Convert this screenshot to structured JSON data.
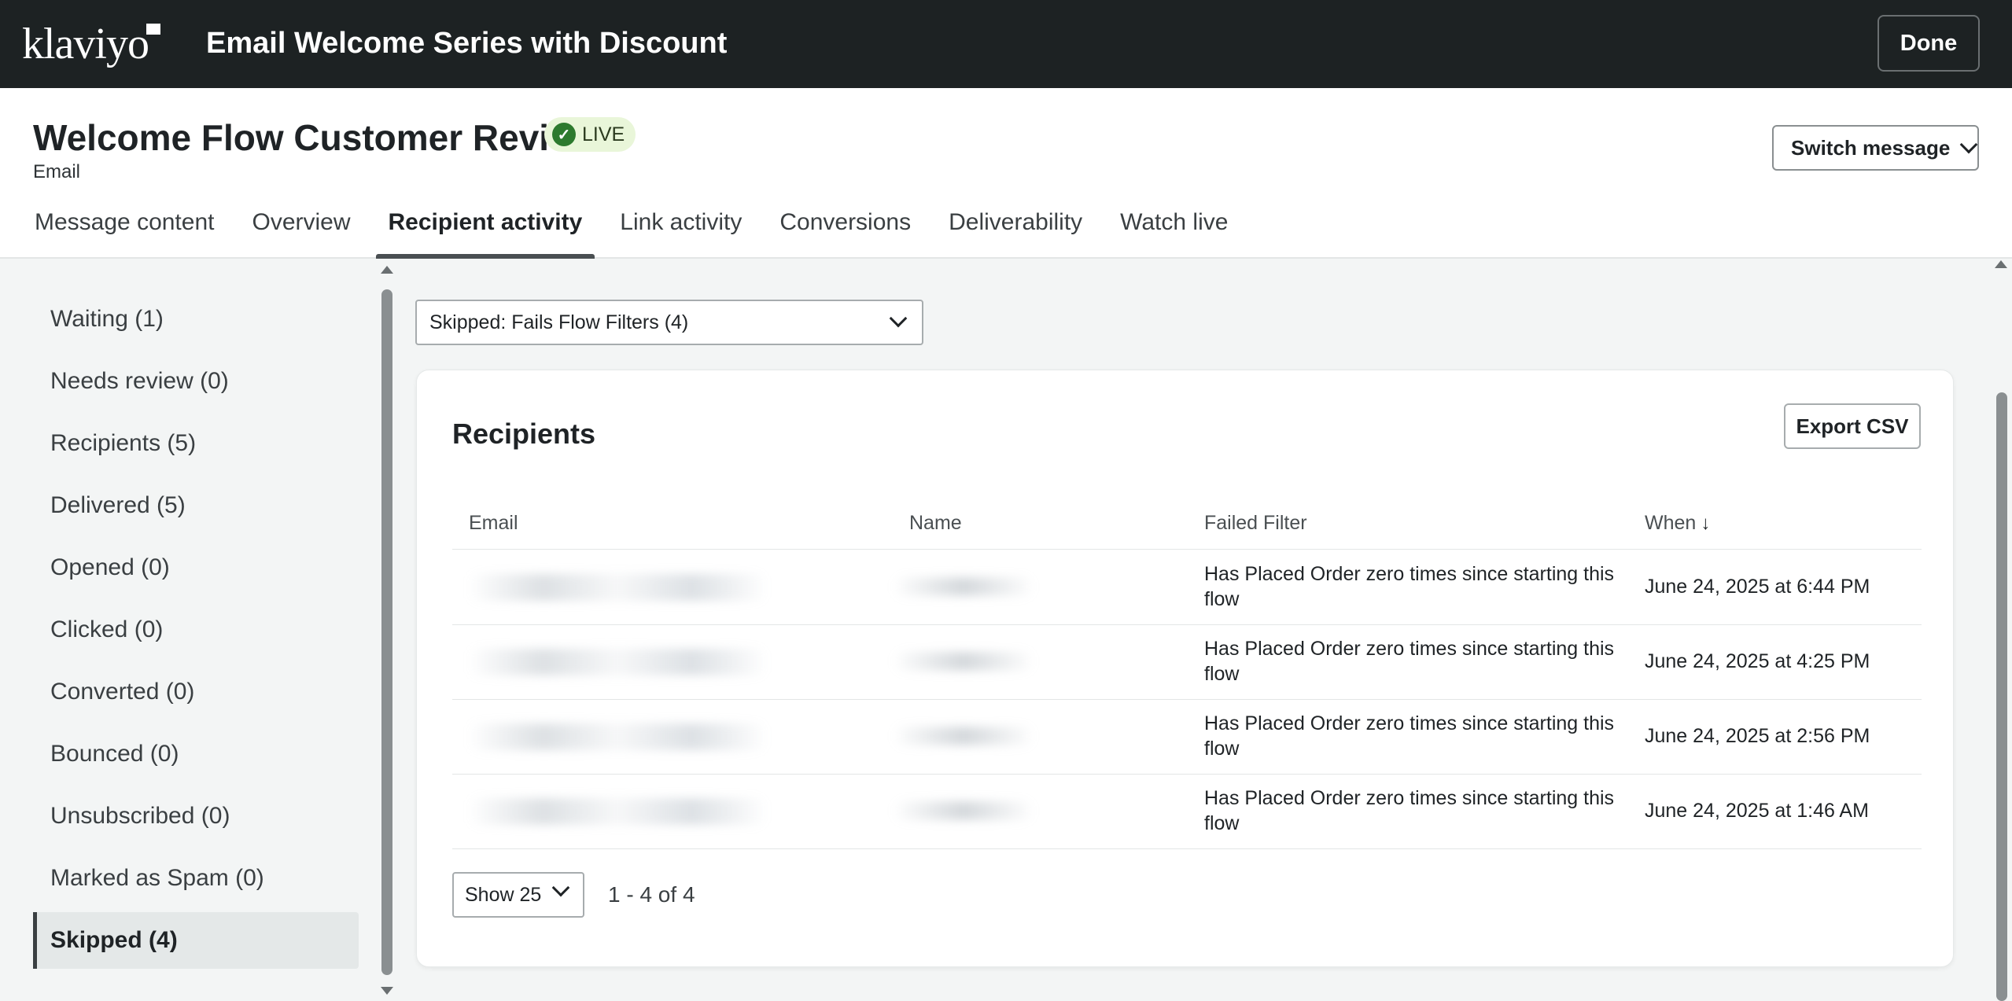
{
  "app": {
    "logo": "klaviyo",
    "flow_title": "Email Welcome Series with Discount",
    "done_label": "Done"
  },
  "message": {
    "title": "Welcome Flow Customer Review",
    "status": "LIVE",
    "type": "Email",
    "switch_label": "Switch message"
  },
  "tabs": [
    {
      "label": "Message content"
    },
    {
      "label": "Overview"
    },
    {
      "label": "Recipient activity"
    },
    {
      "label": "Link activity"
    },
    {
      "label": "Conversions"
    },
    {
      "label": "Deliverability"
    },
    {
      "label": "Watch live"
    }
  ],
  "sidebar": {
    "items": [
      {
        "label": "Waiting (1)"
      },
      {
        "label": "Needs review (0)"
      },
      {
        "label": "Recipients (5)"
      },
      {
        "label": "Delivered (5)"
      },
      {
        "label": "Opened (0)"
      },
      {
        "label": "Clicked (0)"
      },
      {
        "label": "Converted (0)"
      },
      {
        "label": "Bounced (0)"
      },
      {
        "label": "Unsubscribed (0)"
      },
      {
        "label": "Marked as Spam (0)"
      },
      {
        "label": "Skipped (4)"
      }
    ]
  },
  "filter": {
    "selected": "Skipped: Fails Flow Filters (4)"
  },
  "recipients": {
    "title": "Recipients",
    "export_label": "Export CSV",
    "columns": {
      "email": "Email",
      "name": "Name",
      "failed_filter": "Failed Filter",
      "when": "When"
    },
    "rows": [
      {
        "failed_filter": "Has Placed Order zero times since starting this flow",
        "when": "June 24, 2025 at 6:44 PM"
      },
      {
        "failed_filter": "Has Placed Order zero times since starting this flow",
        "when": "June 24, 2025 at 4:25 PM"
      },
      {
        "failed_filter": "Has Placed Order zero times since starting this flow",
        "when": "June 24, 2025 at 2:56 PM"
      },
      {
        "failed_filter": "Has Placed Order zero times since starting this flow",
        "when": "June 24, 2025 at 1:46 AM"
      }
    ],
    "page_size": "Show 25",
    "page_range": "1 - 4 of 4"
  },
  "colors": {
    "topbar": "#1d2223",
    "live_bg": "#e9f6d9",
    "live_icon": "#2d7a2e"
  }
}
